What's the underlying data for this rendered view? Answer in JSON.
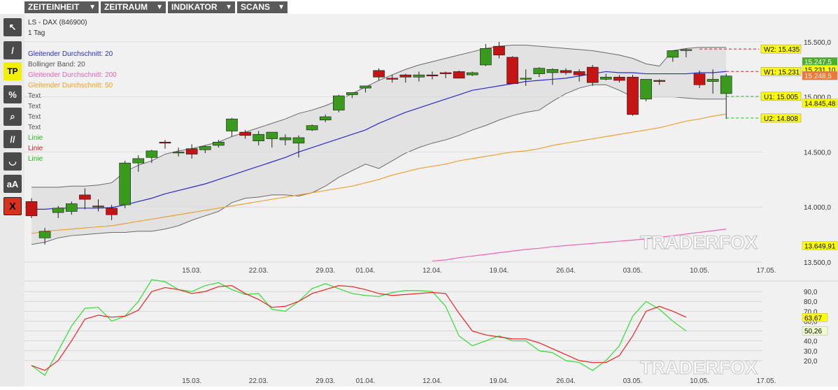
{
  "menu": [
    {
      "label": "ZEITEINHEIT"
    },
    {
      "label": "ZEITRAUM"
    },
    {
      "label": "INDIKATOR"
    },
    {
      "label": "SCANS"
    }
  ],
  "tools": [
    {
      "icon": "cursor-icon",
      "label": "↖"
    },
    {
      "icon": "line-icon",
      "label": "/"
    },
    {
      "icon": "tp-icon",
      "label": "TP"
    },
    {
      "icon": "percent-icon",
      "label": "%"
    },
    {
      "icon": "zoom-icon",
      "label": "⌕"
    },
    {
      "icon": "parallel-lines-icon",
      "label": "//"
    },
    {
      "icon": "curve-icon",
      "label": "◡"
    },
    {
      "icon": "text-size-icon",
      "label": "aA"
    },
    {
      "icon": "delete-icon",
      "label": "X"
    }
  ],
  "chart_data": {
    "type": "candlestick",
    "title": "LS - DAX (846900)",
    "subtitle": "1 Tag",
    "watermark": "TRADERFOX",
    "legend": [
      {
        "label": "Gleitender Durchschnitt: 20",
        "color": "#2a2acf"
      },
      {
        "label": "Bollinger Band: 20",
        "color": "#555555"
      },
      {
        "label": "Gleitender Durchschnitt: 200",
        "color": "#e964b4"
      },
      {
        "label": "Gleitender Durchschnitt: 50",
        "color": "#f0a030"
      },
      {
        "label": "Text",
        "color": "#555555"
      },
      {
        "label": "Text",
        "color": "#555555"
      },
      {
        "label": "Text",
        "color": "#555555"
      },
      {
        "label": "Text",
        "color": "#555555"
      },
      {
        "label": "Linie",
        "color": "#22bb22"
      },
      {
        "label": "Linie",
        "color": "#cc2222"
      },
      {
        "label": "Linie",
        "color": "#22bb22"
      }
    ],
    "ylim": [
      13500,
      15550
    ],
    "yticks": [
      {
        "v": 15500,
        "label": "15.500,0"
      },
      {
        "v": 15000,
        "label": "15.000,0"
      },
      {
        "v": 14500,
        "label": "14.500,0"
      },
      {
        "v": 14000,
        "label": "14.000,0"
      },
      {
        "v": 13500,
        "label": "13.500,0"
      }
    ],
    "x_ticks": [
      {
        "i": 12,
        "label": "15.03."
      },
      {
        "i": 17,
        "label": "22.03."
      },
      {
        "i": 22,
        "label": "29.03."
      },
      {
        "i": 25,
        "label": "01.04."
      },
      {
        "i": 30,
        "label": "12.04."
      },
      {
        "i": 35,
        "label": "19.04."
      },
      {
        "i": 40,
        "label": "26.04."
      },
      {
        "i": 45,
        "label": "03.05."
      },
      {
        "i": 50,
        "label": "10.05."
      },
      {
        "i": 55,
        "label": "17.05."
      }
    ],
    "candles": [
      {
        "o": 14050,
        "h": 14080,
        "l": 13900,
        "c": 13920
      },
      {
        "o": 13720,
        "h": 13810,
        "l": 13660,
        "c": 13780
      },
      {
        "o": 13950,
        "h": 14010,
        "l": 13900,
        "c": 13990
      },
      {
        "o": 13960,
        "h": 14050,
        "l": 13930,
        "c": 14030
      },
      {
        "o": 14110,
        "h": 14170,
        "l": 13980,
        "c": 14070
      },
      {
        "o": 14010,
        "h": 14070,
        "l": 13960,
        "c": 14000
      },
      {
        "o": 13990,
        "h": 14020,
        "l": 13880,
        "c": 13930
      },
      {
        "o": 14020,
        "h": 14420,
        "l": 13990,
        "c": 14400
      },
      {
        "o": 14400,
        "h": 14470,
        "l": 14320,
        "c": 14440
      },
      {
        "o": 14450,
        "h": 14520,
        "l": 14400,
        "c": 14510
      },
      {
        "o": 14590,
        "h": 14610,
        "l": 14530,
        "c": 14580
      },
      {
        "o": 14500,
        "h": 14540,
        "l": 14460,
        "c": 14500
      },
      {
        "o": 14530,
        "h": 14570,
        "l": 14440,
        "c": 14480
      },
      {
        "o": 14520,
        "h": 14560,
        "l": 14490,
        "c": 14550
      },
      {
        "o": 14560,
        "h": 14610,
        "l": 14540,
        "c": 14590
      },
      {
        "o": 14690,
        "h": 14810,
        "l": 14640,
        "c": 14800
      },
      {
        "o": 14680,
        "h": 14700,
        "l": 14620,
        "c": 14650
      },
      {
        "o": 14600,
        "h": 14690,
        "l": 14560,
        "c": 14660
      },
      {
        "o": 14620,
        "h": 14680,
        "l": 14540,
        "c": 14680
      },
      {
        "o": 14610,
        "h": 14660,
        "l": 14560,
        "c": 14630
      },
      {
        "o": 14580,
        "h": 14650,
        "l": 14450,
        "c": 14630
      },
      {
        "o": 14700,
        "h": 14750,
        "l": 14690,
        "c": 14740
      },
      {
        "o": 14790,
        "h": 14840,
        "l": 14770,
        "c": 14820
      },
      {
        "o": 14880,
        "h": 15020,
        "l": 14860,
        "c": 15010
      },
      {
        "o": 15020,
        "h": 15040,
        "l": 14990,
        "c": 15040
      },
      {
        "o": 15080,
        "h": 15100,
        "l": 15040,
        "c": 15100
      },
      {
        "o": 15240,
        "h": 15260,
        "l": 15150,
        "c": 15180
      },
      {
        "o": 15170,
        "h": 15200,
        "l": 15130,
        "c": 15160
      },
      {
        "o": 15200,
        "h": 15210,
        "l": 15130,
        "c": 15180
      },
      {
        "o": 15180,
        "h": 15230,
        "l": 15140,
        "c": 15200
      },
      {
        "o": 15200,
        "h": 15230,
        "l": 15160,
        "c": 15190
      },
      {
        "o": 15220,
        "h": 15230,
        "l": 15170,
        "c": 15210
      },
      {
        "o": 15230,
        "h": 15240,
        "l": 15180,
        "c": 15170
      },
      {
        "o": 15200,
        "h": 15230,
        "l": 15190,
        "c": 15220
      },
      {
        "o": 15290,
        "h": 15480,
        "l": 15280,
        "c": 15440
      },
      {
        "o": 15460,
        "h": 15500,
        "l": 15350,
        "c": 15380
      },
      {
        "o": 15360,
        "h": 15370,
        "l": 15120,
        "c": 15120
      },
      {
        "o": 15170,
        "h": 15250,
        "l": 15100,
        "c": 15170
      },
      {
        "o": 15210,
        "h": 15270,
        "l": 15180,
        "c": 15260
      },
      {
        "o": 15220,
        "h": 15260,
        "l": 15110,
        "c": 15250
      },
      {
        "o": 15240,
        "h": 15260,
        "l": 15200,
        "c": 15220
      },
      {
        "o": 15230,
        "h": 15250,
        "l": 15140,
        "c": 15200
      },
      {
        "o": 15270,
        "h": 15290,
        "l": 15100,
        "c": 15130
      },
      {
        "o": 15160,
        "h": 15210,
        "l": 15150,
        "c": 15180
      },
      {
        "o": 15180,
        "h": 15200,
        "l": 15130,
        "c": 15150
      },
      {
        "o": 15180,
        "h": 15200,
        "l": 14830,
        "c": 14840
      },
      {
        "o": 14980,
        "h": 15160,
        "l": 14960,
        "c": 15160
      },
      {
        "o": 15150,
        "h": 15160,
        "l": 15110,
        "c": 15140
      },
      {
        "o": 15360,
        "h": 15410,
        "l": 15320,
        "c": 15420
      },
      {
        "o": 15430,
        "h": 15440,
        "l": 15360,
        "c": 15430
      },
      {
        "o": 15210,
        "h": 15240,
        "l": 15080,
        "c": 15110
      },
      {
        "o": 15140,
        "h": 15250,
        "l": 15030,
        "c": 15160
      },
      {
        "o": 15030,
        "h": 15210,
        "l": 14800,
        "c": 15190
      }
    ],
    "ma20": [
      13980,
      13980,
      13990,
      13990,
      13990,
      13990,
      13995,
      14020,
      14050,
      14080,
      14120,
      14150,
      14180,
      14210,
      14250,
      14290,
      14330,
      14370,
      14410,
      14450,
      14500,
      14540,
      14580,
      14620,
      14660,
      14700,
      14760,
      14810,
      14860,
      14900,
      14940,
      14980,
      15020,
      15060,
      15080,
      15100,
      15120,
      15140,
      15150,
      15160,
      15170,
      15190,
      15210,
      15230,
      15220,
      15220,
      15210,
      15210,
      15210,
      15210,
      15220,
      15220,
      15231
    ],
    "ma50": [
      13760,
      13780,
      13790,
      13800,
      13810,
      13820,
      13830,
      13850,
      13870,
      13890,
      13910,
      13930,
      13950,
      13970,
      13990,
      14010,
      14030,
      14050,
      14070,
      14090,
      14110,
      14130,
      14150,
      14170,
      14190,
      14220,
      14250,
      14290,
      14320,
      14350,
      14370,
      14390,
      14420,
      14440,
      14460,
      14480,
      14500,
      14510,
      14530,
      14560,
      14580,
      14600,
      14620,
      14640,
      14660,
      14680,
      14700,
      14720,
      14750,
      14780,
      14800,
      14825,
      14845
    ],
    "ma200": [
      null,
      null,
      null,
      null,
      null,
      null,
      null,
      null,
      null,
      null,
      null,
      null,
      null,
      null,
      null,
      null,
      null,
      null,
      null,
      null,
      null,
      null,
      null,
      null,
      null,
      null,
      null,
      null,
      null,
      null,
      13510,
      13520,
      13540,
      13555,
      13570,
      13585,
      13600,
      13615,
      13625,
      13640,
      13650,
      13660,
      13670,
      13680,
      13690,
      13700,
      13710,
      13725,
      13740,
      13755,
      13770,
      13785,
      13800
    ],
    "boll_upper": [
      14180,
      14180,
      14180,
      14190,
      14190,
      14200,
      14220,
      14320,
      14380,
      14420,
      14480,
      14510,
      14530,
      14560,
      14590,
      14640,
      14680,
      14720,
      14760,
      14800,
      14850,
      14880,
      14920,
      14970,
      15030,
      15090,
      15150,
      15200,
      15250,
      15290,
      15320,
      15350,
      15380,
      15410,
      15440,
      15460,
      15470,
      15470,
      15460,
      15450,
      15440,
      15430,
      15420,
      15400,
      15380,
      15350,
      15300,
      15280,
      15420,
      15440,
      15450,
      15450,
      15450
    ],
    "boll_lower": [
      13660,
      13680,
      13720,
      13740,
      13750,
      13760,
      13770,
      13770,
      13780,
      13780,
      13800,
      13830,
      13880,
      13920,
      13960,
      14040,
      14080,
      14090,
      14110,
      14110,
      14100,
      14130,
      14190,
      14270,
      14330,
      14390,
      14350,
      14420,
      14490,
      14540,
      14580,
      14610,
      14650,
      14700,
      14740,
      14790,
      14830,
      14860,
      14880,
      14960,
      15030,
      15080,
      15110,
      15110,
      15060,
      15000,
      15000,
      15000,
      15000,
      14990,
      14980,
      14980,
      14980
    ],
    "levels": [
      {
        "label": "W2: 15.435",
        "v": 15435,
        "color": "#cc2222",
        "start": 50
      },
      {
        "label": "W1: 15.231",
        "v": 15231,
        "color": "#cc2222",
        "start": 52
      },
      {
        "label": "U1: 15.005",
        "v": 15005,
        "color": "#22bb22",
        "start": 52
      },
      {
        "label": "U2: 14.808",
        "v": 14808,
        "color": "#22bb22",
        "start": 52
      }
    ],
    "price_labels": [
      {
        "label": "15.247,5",
        "v": 15320,
        "bg": "#4caf2c",
        "fg": "#ffffff"
      },
      {
        "label": "15.231,10",
        "v": 15250,
        "bg": "#ffff00",
        "fg": "#000000"
      },
      {
        "label": "15.248,5",
        "v": 15193,
        "bg": "#f07830",
        "fg": "#ffffff"
      },
      {
        "label": "14.845,48",
        "v": 14945,
        "bg": "#ffff00",
        "fg": "#000000"
      },
      {
        "label": "13.649,91",
        "v": 13650,
        "bg": "#ffff00",
        "fg": "#000000"
      }
    ],
    "stoch": {
      "ylim": [
        10,
        100
      ],
      "yticks": [
        90,
        80,
        70,
        60,
        50,
        40,
        30,
        20
      ],
      "ytick_labels": [
        "90,0",
        "80,0",
        "70,0",
        "60,0",
        "50,0",
        "40,0",
        "30,0",
        "20,0"
      ],
      "k": [
        15,
        5,
        30,
        55,
        73,
        74,
        60,
        65,
        80,
        102,
        100,
        92,
        90,
        96,
        99,
        92,
        87,
        88,
        72,
        70,
        80,
        93,
        98,
        93,
        88,
        86,
        85,
        89,
        91,
        91,
        90,
        75,
        45,
        35,
        40,
        45,
        40,
        40,
        30,
        28,
        20,
        18,
        10,
        20,
        35,
        65,
        80,
        72,
        60,
        50
      ],
      "d": [
        15,
        10,
        20,
        40,
        62,
        66,
        64,
        65,
        71,
        90,
        94,
        92,
        88,
        90,
        95,
        96,
        88,
        82,
        74,
        75,
        80,
        88,
        92,
        96,
        95,
        92,
        88,
        86,
        87,
        88,
        89,
        88,
        68,
        50,
        46,
        44,
        42,
        42,
        38,
        32,
        26,
        20,
        18,
        18,
        25,
        45,
        70,
        75,
        70,
        64
      ],
      "labels": [
        {
          "label": "63,67",
          "v": 63.67,
          "bg": "#ffff00",
          "fg": "#000000"
        },
        {
          "label": "50,26",
          "v": 50.26,
          "bg": "#eeffcc",
          "fg": "#000000"
        }
      ]
    }
  }
}
